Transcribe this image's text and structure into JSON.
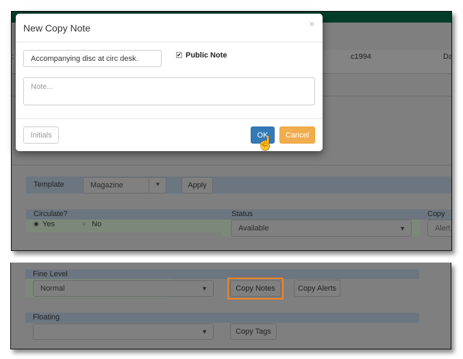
{
  "background": {
    "year": "c1994",
    "cut_text": "Da",
    "colon": ":"
  },
  "modal": {
    "title": "New Copy Note",
    "close": "×",
    "note_title_value": "Accompanying disc at circ desk.",
    "public_note_label": "Public Note",
    "public_note_checked": true,
    "note_placeholder": "Note...",
    "initials_placeholder": "Initials",
    "ok": "OK",
    "cancel": "Cancel"
  },
  "form": {
    "template_label": "Template",
    "template_value": "Magazine",
    "apply": "Apply",
    "circulate_label": "Circulate?",
    "yes": "Yes",
    "no": "No",
    "status_label": "Status",
    "status_value": "Available",
    "copy_alerts_label": "Copy A",
    "alert_placeholder": "Alert"
  },
  "lower": {
    "fine_level_label": "Fine Level",
    "fine_level_value": "Normal",
    "copy_notes": "Copy Notes",
    "copy_alerts": "Copy Alerts",
    "floating_label": "Floating",
    "floating_value": "",
    "copy_tags": "Copy Tags"
  },
  "colors": {
    "header_green": "#003d28",
    "highlight": "#f58220",
    "ok": "#337ab7",
    "cancel": "#f0ad4e"
  }
}
